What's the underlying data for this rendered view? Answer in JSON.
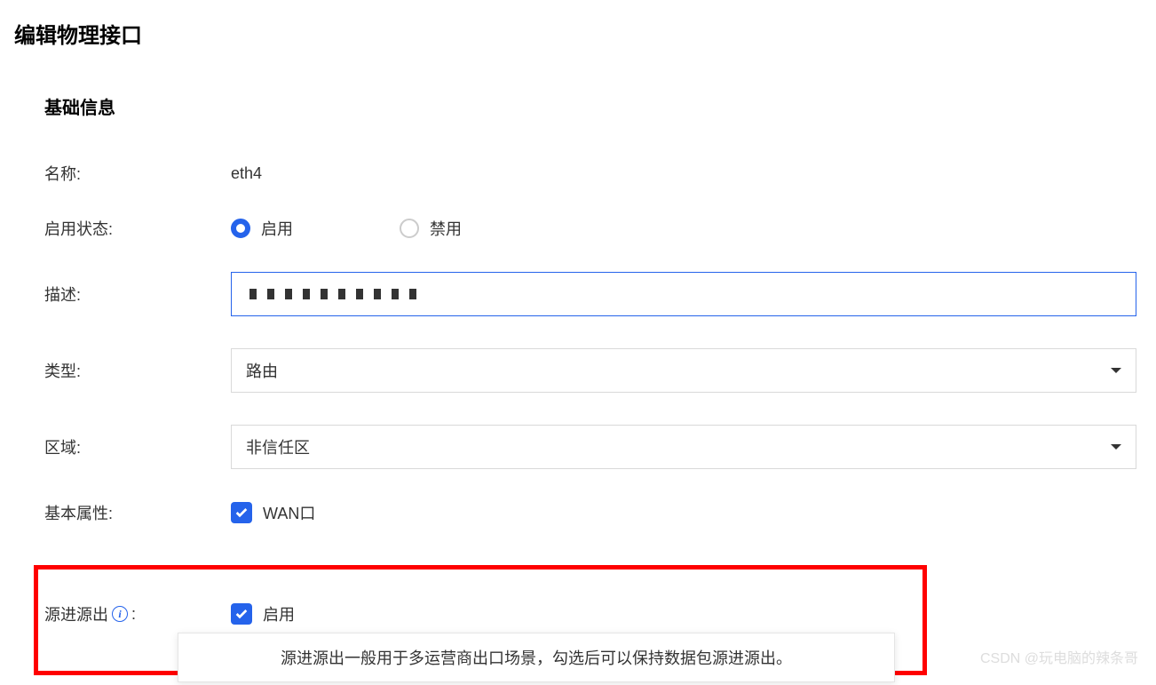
{
  "page": {
    "title": "编辑物理接口"
  },
  "section": {
    "title": "基础信息"
  },
  "form": {
    "name": {
      "label": "名称:",
      "value": "eth4"
    },
    "enable_state": {
      "label": "启用状态:",
      "option_enable": "启用",
      "option_disable": "禁用",
      "selected": "enable"
    },
    "description": {
      "label": "描述:",
      "value": ""
    },
    "type": {
      "label": "类型:",
      "value": "路由"
    },
    "zone": {
      "label": "区域:",
      "value": "非信任区"
    },
    "basic_attr": {
      "label": "基本属性:",
      "checkbox_label": "WAN口",
      "checked": true
    },
    "source_in_out": {
      "label": "源进源出",
      "colon": ":",
      "checkbox_label": "启用",
      "checked": true,
      "tooltip": "源进源出一般用于多运营商出口场景，勾选后可以保持数据包源进源出。"
    }
  },
  "watermark": "CSDN @玩电脑的辣条哥"
}
